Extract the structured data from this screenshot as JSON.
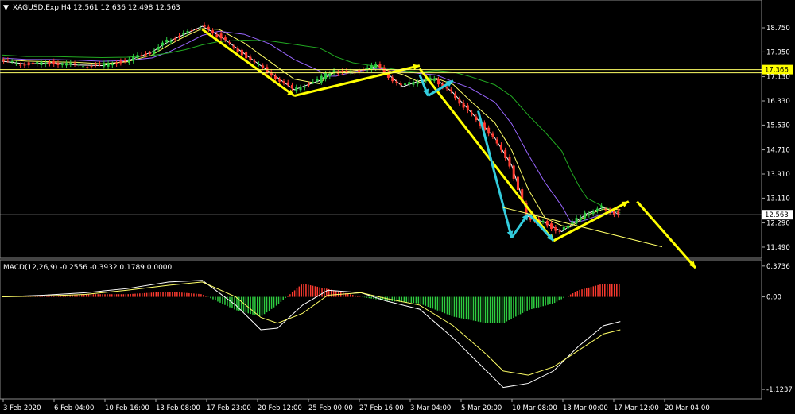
{
  "header": {
    "symbol_line": "XAGUSD.Exp,H4  12.561 12.636 12.498 12.563"
  },
  "macd": {
    "label": "MACD(12,26,9) -0.2556 -0.3932 0.1789 0.0000"
  },
  "colors": {
    "background": "#000000",
    "grid": "#ffffff",
    "candle_up": "#2ecc40",
    "candle_down": "#ff3b30",
    "ma_yellow": "#ffff66",
    "ma_white": "#ffffff",
    "ma_purple": "#9966ff",
    "ma_green": "#22aa22",
    "arrow_yellow": "#ffff00",
    "arrow_cyan": "#33ccdd",
    "hist_up": "#ff3b30",
    "hist_down": "#2ecc40"
  },
  "chart_data": {
    "type": "line",
    "price_axis": {
      "ticks": [
        "18.750",
        "17.950",
        "17.130",
        "16.330",
        "15.530",
        "14.710",
        "13.910",
        "13.110",
        "12.290",
        "11.490"
      ],
      "tick_values": [
        18.75,
        17.95,
        17.13,
        16.33,
        15.53,
        14.71,
        13.91,
        13.11,
        12.29,
        11.49
      ],
      "range": [
        11.2,
        19.25
      ],
      "highlight_labels": [
        "17.366",
        "12.563"
      ],
      "highlight_values": [
        17.366,
        12.563
      ]
    },
    "macd_axis": {
      "ticks": [
        "0.3736",
        "0.00",
        "-1.1237"
      ],
      "tick_values": [
        0.3736,
        0.0,
        -1.1237
      ],
      "range": [
        -1.2,
        0.42
      ]
    },
    "time_axis": {
      "labels": [
        "3 Feb 2020",
        "6 Feb 04:00",
        "10 Feb 16:00",
        "13 Feb 08:00",
        "17 Feb 23:00",
        "20 Feb 12:00",
        "25 Feb 00:00",
        "27 Feb 16:00",
        "3 Mar 04:00",
        "5 Mar 20:00",
        "10 Mar 08:00",
        "13 Mar 00:00",
        "17 Mar 12:00",
        "20 Mar 04:00"
      ]
    },
    "price_series": {
      "x": [
        0,
        6,
        12,
        18,
        24,
        30,
        36,
        40,
        44,
        48,
        52,
        58,
        64,
        70,
        76,
        78,
        80,
        84,
        90,
        96,
        100,
        104,
        108,
        112,
        118,
        122,
        126,
        130,
        134,
        136,
        138,
        140,
        144,
        148
      ],
      "close": [
        17.65,
        17.55,
        17.6,
        17.52,
        17.5,
        17.65,
        17.95,
        18.3,
        18.55,
        18.8,
        18.5,
        17.9,
        17.3,
        16.7,
        17.0,
        17.2,
        17.3,
        17.25,
        17.5,
        16.8,
        17.0,
        17.05,
        16.6,
        16.0,
        15.1,
        14.2,
        12.5,
        12.3,
        12.0,
        12.2,
        12.4,
        12.6,
        12.8,
        12.56
      ]
    },
    "macd_series": {
      "x": [
        0,
        10,
        20,
        30,
        40,
        48,
        56,
        62,
        66,
        72,
        78,
        86,
        92,
        100,
        108,
        116,
        120,
        126,
        132,
        138,
        144,
        148
      ],
      "main": [
        0.0,
        0.02,
        0.05,
        0.1,
        0.18,
        0.2,
        -0.1,
        -0.4,
        -0.38,
        -0.1,
        0.08,
        0.05,
        -0.05,
        -0.15,
        -0.5,
        -0.9,
        -1.1,
        -1.05,
        -0.9,
        -0.6,
        -0.35,
        -0.3
      ],
      "signal": [
        0.0,
        0.01,
        0.03,
        0.08,
        0.14,
        0.18,
        0.0,
        -0.25,
        -0.32,
        -0.2,
        0.02,
        0.05,
        -0.02,
        -0.1,
        -0.35,
        -0.7,
        -0.9,
        -0.95,
        -0.85,
        -0.65,
        -0.45,
        -0.4
      ]
    }
  }
}
